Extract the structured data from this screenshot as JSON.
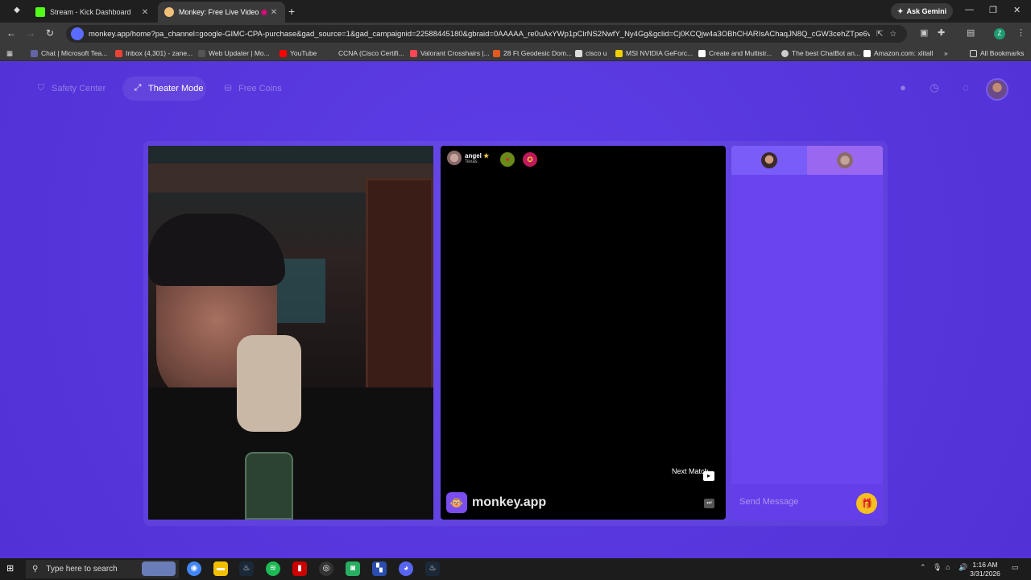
{
  "browser": {
    "tabs": [
      {
        "title": "Stream - Kick Dashboard",
        "favicon_color": "#53fc18"
      },
      {
        "title": "Monkey: Free Live Video Ch",
        "favicon_color": "#f2c07a"
      }
    ],
    "url": "monkey.app/home?pa_channel=google-GIMC-CPA-purchase&gad_source=1&gad_campaignid=22588445180&gbraid=0AAAAA_re0uAxYWp1pClrNS2NwfY_Ny4Gg&gclid=Cj0KCQjw4a3OBhCHARIsAChaqJN8Q_cGW3cehZTpe6vE8Dh_B...",
    "ask_gemini": "Ask Gemini",
    "profile_letter": "Z",
    "bookmarks": [
      "Chat | Microsoft Tea...",
      "Inbox (4,301) - zane...",
      "Web Updater | Mo...",
      "YouTube",
      "CCNA (Cisco Certifi...",
      "Valorant Crosshairs |...",
      "28 Ft Geodesic Dom...",
      "cisco u",
      "MSI NVIDIA GeForc...",
      "Create and Multistr...",
      "The best ChatBot an...",
      "Amazon.com: xlitall"
    ],
    "all_bookmarks": "All Bookmarks"
  },
  "app": {
    "nav": {
      "safety_center": "Safety Center",
      "theater_mode": "Theater Mode",
      "free_coins": "Free Coins"
    },
    "stranger": {
      "name": "angel",
      "location": "Texas"
    },
    "next_match": "Next Match",
    "brand": "monkey.app",
    "message_placeholder": "Send Message"
  },
  "taskbar": {
    "search_placeholder": "Type here to search",
    "time": "1:16 AM",
    "date": "3/31/2026"
  },
  "colors": {
    "page_bg": "#5b3be0",
    "chat_panel": "#6a44ef",
    "gift": "#f4c020"
  }
}
